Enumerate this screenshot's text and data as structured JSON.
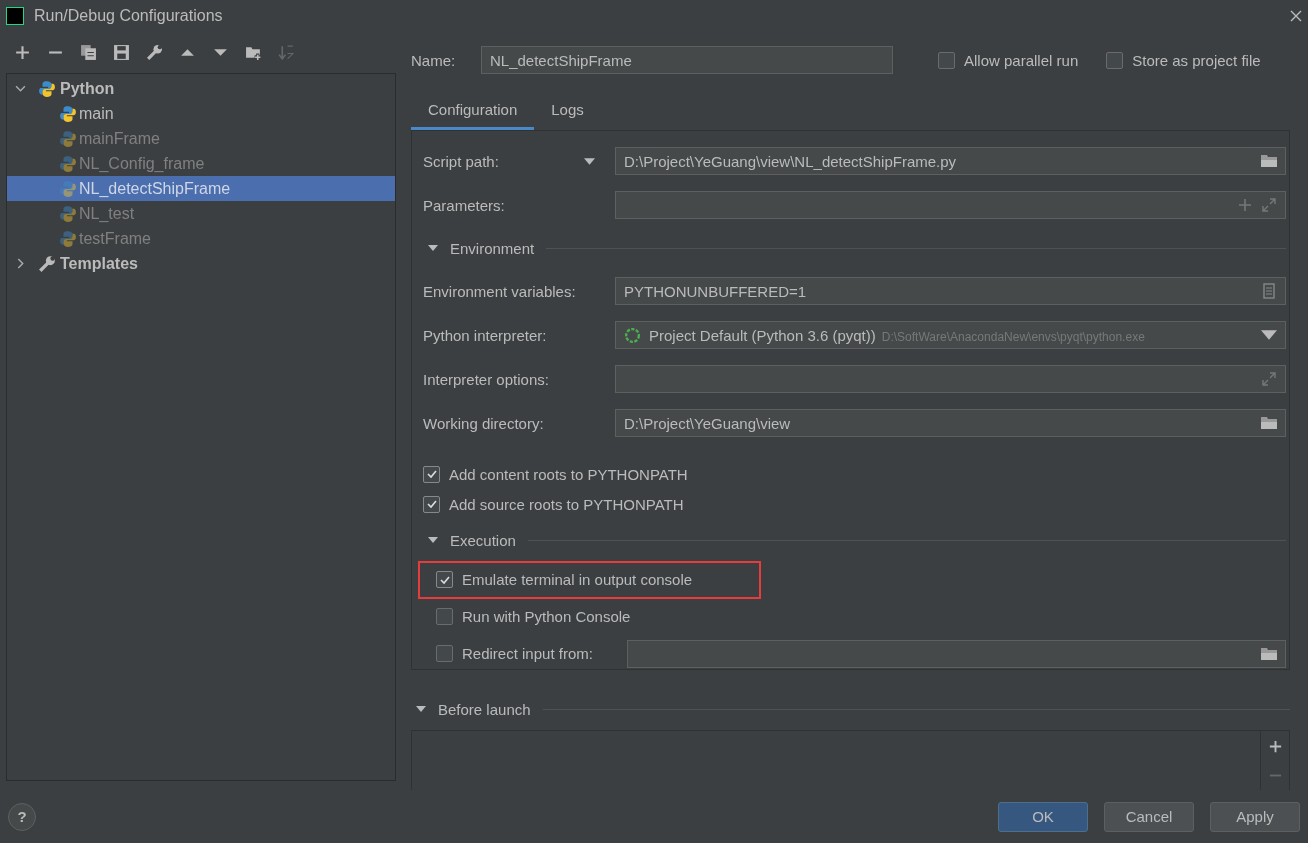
{
  "window": {
    "title": "Run/Debug Configurations"
  },
  "tree": [
    {
      "label": "Python",
      "kind": "python",
      "expanded": true,
      "children": [
        {
          "label": "main",
          "temporary": false,
          "selected": false
        },
        {
          "label": "mainFrame",
          "temporary": true,
          "selected": false
        },
        {
          "label": "NL_Config_frame",
          "temporary": true,
          "selected": false
        },
        {
          "label": "NL_detectShipFrame",
          "temporary": true,
          "selected": true
        },
        {
          "label": "NL_test",
          "temporary": true,
          "selected": false
        },
        {
          "label": "testFrame",
          "temporary": true,
          "selected": false
        }
      ]
    },
    {
      "label": "Templates",
      "kind": "wrench",
      "expanded": false
    }
  ],
  "help": {
    "label": "?"
  },
  "name": {
    "label": "Name:",
    "value": "NL_detectShipFrame"
  },
  "options": [
    {
      "label": "Allow parallel run",
      "checked": false
    },
    {
      "label": "Store as project file",
      "checked": false
    }
  ],
  "tabs": [
    {
      "label": "Configuration",
      "selected": true
    },
    {
      "label": "Logs",
      "selected": false
    }
  ],
  "script_path": {
    "label": "Script path:",
    "value": "D:\\Project\\YeGuang\\view\\NL_detectShipFrame.py"
  },
  "parameters": {
    "label": "Parameters:"
  },
  "environment": {
    "title": "Environment",
    "expanded": true,
    "fields": [
      {
        "kind": "text",
        "label": "Environment variables:",
        "value": "PYTHONUNBUFFERED=1"
      },
      {
        "kind": "interpreter",
        "label": "Python interpreter:",
        "value": "Project Default (Python 3.6 (pyqt))",
        "hint": "D:\\SoftWare\\AnacondaNew\\envs\\pyqt\\python.exe"
      },
      {
        "kind": "expand",
        "label": "Interpreter options:"
      },
      {
        "kind": "folder",
        "label": "Working directory:",
        "value": "D:\\Project\\YeGuang\\view"
      }
    ]
  },
  "paths": [
    {
      "label": "Add content roots to PYTHONPATH",
      "checked": true
    },
    {
      "label": "Add source roots to PYTHONPATH",
      "checked": true
    }
  ],
  "execution": {
    "title": "Execution",
    "expanded": true,
    "options": [
      {
        "kind": "check",
        "label": "Emulate terminal in output console",
        "checked": true,
        "highlighted": true
      },
      {
        "kind": "check",
        "label": "Run with Python Console",
        "checked": false,
        "highlighted": false
      },
      {
        "kind": "field",
        "label": "Redirect input from:",
        "checked": false,
        "highlighted": false
      }
    ]
  },
  "before_launch": {
    "title": "Before launch",
    "expanded": true
  },
  "buttons": [
    {
      "label": "OK",
      "primary": true
    },
    {
      "label": "Cancel",
      "primary": false
    },
    {
      "label": "Apply",
      "primary": false
    }
  ]
}
